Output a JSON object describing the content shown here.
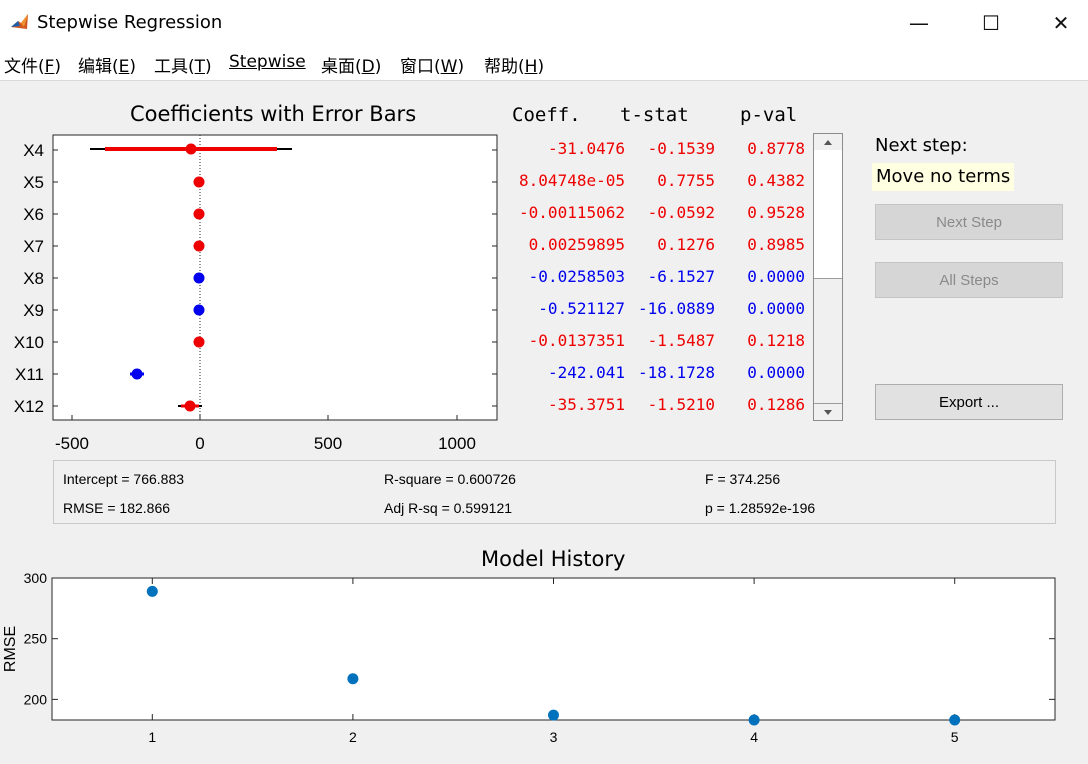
{
  "window": {
    "title": "Stepwise Regression",
    "minimize": "—",
    "maximize": "☐",
    "close": "✕"
  },
  "menu": [
    {
      "label": "文件",
      "key": "F"
    },
    {
      "label": "编辑",
      "key": "E"
    },
    {
      "label": "工具",
      "key": "T"
    },
    {
      "label": "Stepwise",
      "key": ""
    },
    {
      "label": "桌面",
      "key": "D"
    },
    {
      "label": "窗口",
      "key": "W"
    },
    {
      "label": "帮助",
      "key": "H"
    }
  ],
  "coef_plot": {
    "title": "Coefficients with Error Bars",
    "xticks": [
      "-500",
      "0",
      "500",
      "1000"
    ]
  },
  "table": {
    "headers": {
      "coeff": "Coeff.",
      "tstat": "t-stat",
      "pval": "p-val"
    },
    "rows": [
      {
        "name": "X4",
        "coeff": "-31.0476",
        "tstat": "-0.1539",
        "pval": "0.8778",
        "in_model": false
      },
      {
        "name": "X5",
        "coeff": "8.04748e-05",
        "tstat": "0.7755",
        "pval": "0.4382",
        "in_model": false
      },
      {
        "name": "X6",
        "coeff": "-0.00115062",
        "tstat": "-0.0592",
        "pval": "0.9528",
        "in_model": false
      },
      {
        "name": "X7",
        "coeff": "0.00259895",
        "tstat": "0.1276",
        "pval": "0.8985",
        "in_model": false
      },
      {
        "name": "X8",
        "coeff": "-0.0258503",
        "tstat": "-6.1527",
        "pval": "0.0000",
        "in_model": true
      },
      {
        "name": "X9",
        "coeff": "-0.521127",
        "tstat": "-16.0889",
        "pval": "0.0000",
        "in_model": true
      },
      {
        "name": "X10",
        "coeff": "-0.0137351",
        "tstat": "-1.5487",
        "pval": "0.1218",
        "in_model": false
      },
      {
        "name": "X11",
        "coeff": "-242.041",
        "tstat": "-18.1728",
        "pval": "0.0000",
        "in_model": true
      },
      {
        "name": "X12",
        "coeff": "-35.3751",
        "tstat": "-1.5210",
        "pval": "0.1286",
        "in_model": false
      }
    ]
  },
  "next_step": {
    "label": "Next step:",
    "value": "Move no terms"
  },
  "buttons": {
    "next_step": "Next Step",
    "all_steps": "All Steps",
    "export": "Export ..."
  },
  "stats": {
    "intercept": "Intercept = 766.883",
    "rmse": "RMSE = 182.866",
    "rsquare": "R-square = 0.600726",
    "adj_rsq": "Adj R-sq = 0.599121",
    "f": "F = 374.256",
    "p": "p = 1.28592e-196"
  },
  "colors": {
    "in_model": "#0000ee",
    "out_model": "#ee0000",
    "history_point": "#0072bd"
  },
  "chart_data": {
    "type": "scatter",
    "title": "Model History",
    "xlabel": "",
    "ylabel": "RMSE",
    "x": [
      1,
      2,
      3,
      4,
      5
    ],
    "y": [
      289,
      217,
      187,
      183,
      183
    ],
    "xlim": [
      0.5,
      5.5
    ],
    "ylim": [
      183,
      300
    ],
    "xticks": [
      "1",
      "2",
      "3",
      "4",
      "5"
    ],
    "yticks": [
      "200",
      "250",
      "300"
    ],
    "grid": false
  }
}
